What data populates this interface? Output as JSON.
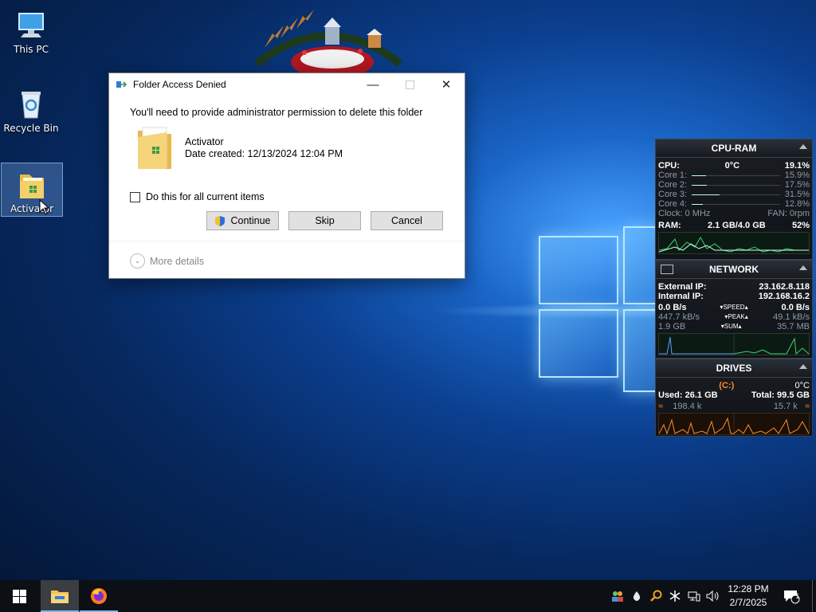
{
  "desktop": {
    "icons": [
      {
        "label": "This PC"
      },
      {
        "label": "Recycle Bin"
      },
      {
        "label": "Activator"
      }
    ]
  },
  "dialog": {
    "title": "Folder Access Denied",
    "message": "You'll need to provide administrator permission to delete this folder",
    "item_name": "Activator",
    "item_date": "Date created: 12/13/2024 12:04 PM",
    "checkbox_label": "Do this for all current items",
    "checkbox_checked": false,
    "continue_label": "Continue",
    "skip_label": "Skip",
    "cancel_label": "Cancel",
    "more_details_label": "More details",
    "minimize_glyph": "—",
    "close_glyph": "✕"
  },
  "cpu_ram": {
    "title": "CPU-RAM",
    "cpu_label": "CPU:",
    "cpu_temp": "0°C",
    "cpu_usage": "19.1%",
    "cores": [
      {
        "label": "Core 1:",
        "value": "15.9%",
        "level": 0.159
      },
      {
        "label": "Core 2:",
        "value": "17.5%",
        "level": 0.175
      },
      {
        "label": "Core 3:",
        "value": "31.5%",
        "level": 0.315
      },
      {
        "label": "Core 4:",
        "value": "12.8%",
        "level": 0.128
      }
    ],
    "clock": "Clock: 0 MHz",
    "fan": "FAN: 0rpm",
    "ram_label": "RAM:",
    "ram_used": "2.1 GB/4.0 GB",
    "ram_percent": "52%"
  },
  "network": {
    "title": "NETWORK",
    "external_label": "External IP:",
    "external_ip": "23.162.8.118",
    "internal_label": "Internal IP:",
    "internal_ip": "192.168.16.2",
    "down_speed": "0.0 B/s",
    "speed_label": "SPEED",
    "up_speed": "0.0 B/s",
    "down_peak": "447.7 kB/s",
    "peak_label": "PEAK",
    "up_peak": "49.1 kB/s",
    "down_sum": "1.9 GB",
    "sum_label": "SUM",
    "up_sum": "35.7 MB"
  },
  "drives": {
    "title": "DRIVES",
    "drive_letter": "(C:)",
    "temp": "0°C",
    "used": "Used: 26.1 GB",
    "total": "Total: 99.5 GB",
    "read": "198.4 k",
    "write": "15.7 k"
  },
  "taskbar": {
    "time": "12:28 PM",
    "date": "2/7/2025",
    "notification_count": "1"
  },
  "colors": {
    "accent": "#76b9ed",
    "drive_orange": "#ff8a2a",
    "graph_green": "#3fd36a"
  }
}
